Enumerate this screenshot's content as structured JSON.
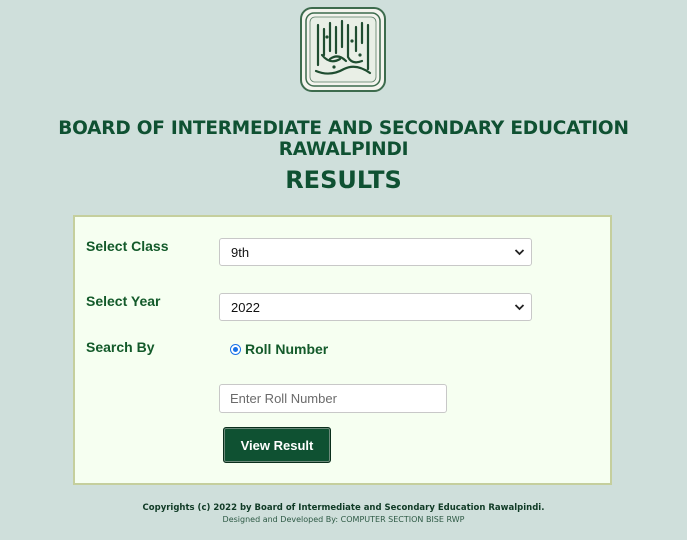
{
  "header": {
    "logo_icon": "bise-rawalpindi-calligraphy-logo",
    "board_title": "BOARD OF INTERMEDIATE AND SECONDARY EDUCATION RAWALPINDI",
    "page_title": "RESULTS"
  },
  "form": {
    "class_label": "Select Class",
    "class_value": "9th",
    "year_label": "Select Year",
    "year_value": "2022",
    "search_by_label": "Search By",
    "search_by_option": "Roll Number",
    "roll_placeholder": "Enter Roll Number",
    "submit_label": "View Result"
  },
  "footer": {
    "copyright": "Copyrights (c) 2022 by Board of Intermediate and Secondary Education Rawalpindi.",
    "credit": "Designed and Developed By: COMPUTER SECTION BISE RWP"
  },
  "colors": {
    "background": "#cfdfdb",
    "brand_green": "#0f5132",
    "panel": "#f6fff1"
  }
}
